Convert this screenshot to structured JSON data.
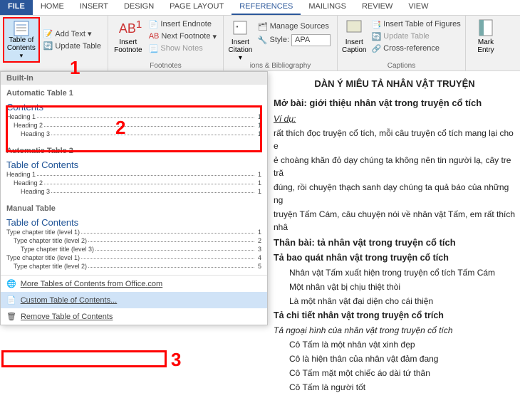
{
  "tabs": {
    "file": "FILE",
    "home": "HOME",
    "insert": "INSERT",
    "design": "DESIGN",
    "page_layout": "PAGE LAYOUT",
    "references": "REFERENCES",
    "mailings": "MAILINGS",
    "review": "REVIEW",
    "view": "VIEW"
  },
  "ribbon": {
    "toc": "Table of Contents",
    "add_text": "Add Text",
    "update_table": "Update Table",
    "insert_footnote": "Insert Footnote",
    "insert_endnote": "Insert Endnote",
    "next_footnote": "Next Footnote",
    "show_notes": "Show Notes",
    "insert_citation": "Insert Citation",
    "manage_sources": "Manage Sources",
    "style": "Style:",
    "style_val": "APA",
    "insert_caption": "Insert Caption",
    "insert_tof": "Insert Table of Figures",
    "update_table2": "Update Table",
    "cross_ref": "Cross-reference",
    "mark_entry": "Mark Entry",
    "g_footnotes": "Footnotes",
    "g_citations": "ions & Bibliography",
    "g_captions": "Captions"
  },
  "dd": {
    "builtin": "Built-In",
    "auto1": "Automatic Table 1",
    "auto1_title": "Contents",
    "h1": "Heading 1",
    "h2": "Heading 2",
    "h3": "Heading 3",
    "pg1": "1",
    "auto2": "Automatic Table 2",
    "auto2_title": "Table of Contents",
    "manual": "Manual Table",
    "manual_title": "Table of Contents",
    "m1": "Type chapter title (level 1)",
    "m2": "Type chapter title (level 2)",
    "m3": "Type chapter title (level 3)",
    "mp1": "1",
    "mp2": "2",
    "mp3": "3",
    "mp4": "4",
    "mp5": "5",
    "more": "More Tables of Contents from Office.com",
    "custom": "Custom Table of Contents...",
    "remove": "Remove Table of Contents"
  },
  "marks": {
    "m1": "1",
    "m2": "2",
    "m3": "3"
  },
  "doc": {
    "title": "DÀN Ý MIÊU TẢ NHÂN VẬT TRUYỆN",
    "h1a": "Mở bài: giới thiệu nhân vật trong truyện cổ tích",
    "vidu": "Ví dụ:",
    "p1": "rất thích đọc truyện cổ tích, mỗi câu truyện cổ tích mang lại cho e",
    "p2": "ẻ choàng khăn đỏ dạy chúng ta không nên tin người lạ, cây tre tră",
    "p3": "đúng, rồi chuyện thạch sanh dạy chúng ta quả báo của những ng",
    "p4": "truyện Tấm Cám, câu chuyện nói về nhân vật Tấm, em rất thích nhâ",
    "h1b": "Thân bài: tả nhân vật trong truyện cổ tích",
    "h2a": "Tả bao quát nhân vật trong truyện cổ tích",
    "b1": "Nhân vật Tấm xuất hiện trong truyện cổ tích Tấm Cám",
    "b2": "Một nhân vật bị chịu thiệt thòi",
    "b3": "Là một nhân vật đại diện cho cái thiện",
    "h2b": "Tả chi tiết nhân vật trong truyện cổ trích",
    "h3a": "Tả ngoại hình của nhân vật trong truyện cổ tích",
    "c1": "Cô Tấm là một nhân vật xinh đẹp",
    "c2": "Cô là hiện thân của nhân vật đảm đang",
    "c3": "Cô Tấm mặt một chiếc áo dài tứ thân",
    "c4": "Cô Tấm là người tốt"
  }
}
